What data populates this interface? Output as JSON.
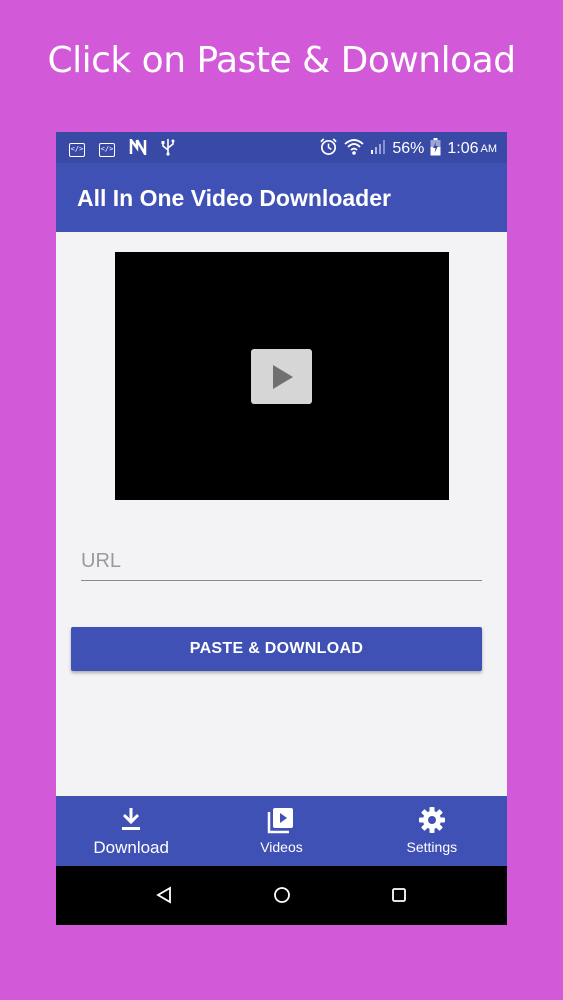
{
  "promo": {
    "caption": "Click on Paste & Download"
  },
  "status_bar": {
    "battery": "56%",
    "time": "1:06",
    "ampm": "AM",
    "icons": [
      "code-icon",
      "code-icon",
      "n-icon",
      "usb-icon",
      "alarm-icon",
      "wifi-icon",
      "signal-icon",
      "battery-charging-icon"
    ]
  },
  "app_bar": {
    "title": "All In One Video Downloader"
  },
  "video_player": {
    "play_icon": "play-icon"
  },
  "url_field": {
    "value": "",
    "placeholder": "URL"
  },
  "paste_button": {
    "label": "PASTE & DOWNLOAD"
  },
  "bottom_nav": {
    "items": [
      {
        "label": "Download",
        "icon": "download-icon",
        "active": true
      },
      {
        "label": "Videos",
        "icon": "video-library-icon",
        "active": false
      },
      {
        "label": "Settings",
        "icon": "gear-icon",
        "active": false
      }
    ]
  },
  "system_nav": {
    "icons": [
      "back-icon",
      "home-icon",
      "recents-icon"
    ]
  },
  "colors": {
    "background": "#d25ad9",
    "primary": "#3f51b5",
    "primary_dark": "#3949a6",
    "content_bg": "#f3f3f6"
  }
}
